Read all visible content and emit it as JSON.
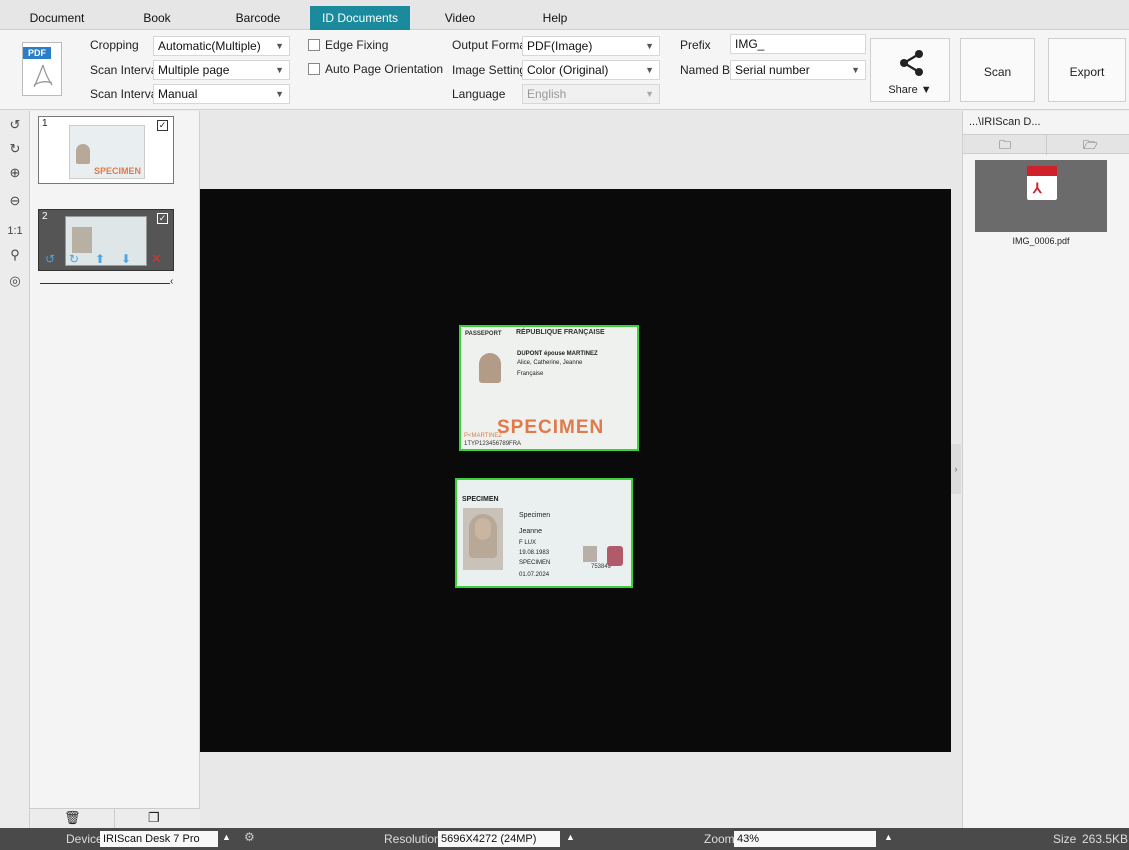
{
  "tabs": [
    {
      "label": "Document"
    },
    {
      "label": "Book"
    },
    {
      "label": "Barcode"
    },
    {
      "label": "ID Documents"
    },
    {
      "label": "Video"
    },
    {
      "label": "Help"
    }
  ],
  "toolbar": {
    "pdf_icon_label": "PDF",
    "cropping_label": "Cropping",
    "cropping_value": "Automatic(Multiple)",
    "scan_interval_label_1": "Scan Interval",
    "scan_interval_value_1": "Multiple page",
    "scan_interval_label_2": "Scan Interval",
    "scan_interval_value_2": "Manual",
    "edge_fixing_label": "Edge Fixing",
    "auto_orientation_label": "Auto Page Orientation",
    "output_format_label": "Output Format",
    "output_format_value": "PDF(Image)",
    "image_settings_label": "Image Settings",
    "image_settings_value": "Color (Original)",
    "language_label": "Language",
    "language_value": "English",
    "prefix_label": "Prefix",
    "prefix_value": "IMG_",
    "named_by_label": "Named By",
    "named_by_value": "Serial number",
    "share_label": "Share ▼",
    "scan_label": "Scan",
    "export_label": "Export"
  },
  "thumbnails": [
    {
      "number": "1"
    },
    {
      "number": "2"
    }
  ],
  "right_panel": {
    "path": "...\\IRIScan D...",
    "file_name": "IMG_0006.pdf"
  },
  "scan_preview": {
    "passport_header_1": "PASSEPORT",
    "passport_header_2": "RÉPUBLIQUE FRANÇAISE",
    "passport_name": "DUPONT épouse MARTINEZ",
    "passport_given": "Alice, Catherine, Jeanne",
    "passport_nat": "Française",
    "passport_mrz_1": "P<MARTINEZ",
    "passport_mrz_2": "1TYP123456789FRA",
    "passport_stamp": "SPECIMEN",
    "id_header": "SPECIMEN",
    "id_surname": "Specimen",
    "id_given": "Jeanne",
    "id_sex_nat": "F    LUX",
    "id_dob": "19.08.1983",
    "id_number": "SPECIMEN",
    "id_expiry": "01.07.2024",
    "id_card_no": "753849"
  },
  "status": {
    "device_label": "Device",
    "device_value": "IRIScan Desk 7 Pro",
    "resolution_label": "Resolution",
    "resolution_value": "5696X4272 (24MP)",
    "zoom_label": "Zoom",
    "zoom_value": "43%",
    "size_label": "Size",
    "size_value": "263.5KB"
  },
  "colors": {
    "accent": "#1a8a9c",
    "crop_border": "#3bd13b",
    "status_bar": "#4a4a4a",
    "stamp": "#e07a4a"
  }
}
